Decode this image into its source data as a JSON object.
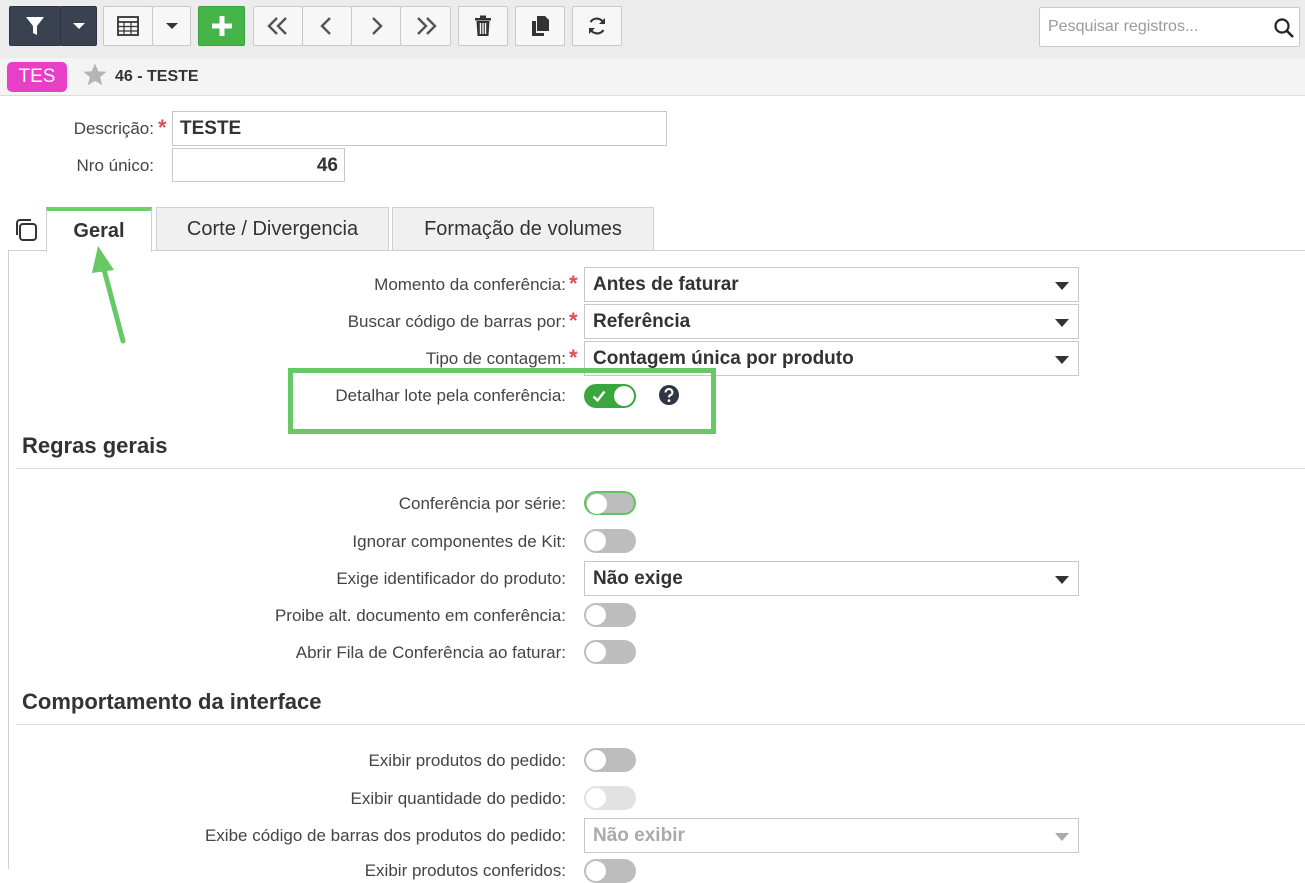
{
  "toolbar": {
    "search_placeholder": "Pesquisar registros..."
  },
  "record": {
    "badge": "TES",
    "title": "46 - TESTE"
  },
  "form": {
    "descricao_label": "Descrição:",
    "descricao_value": "TESTE",
    "nro_label": "Nro único:",
    "nro_value": "46"
  },
  "tabs": [
    {
      "label": "Geral",
      "active": true
    },
    {
      "label": "Corte / Divergencia",
      "active": false
    },
    {
      "label": "Formação de volumes",
      "active": false
    }
  ],
  "geral": {
    "momento_label": "Momento da conferência:",
    "momento_value": "Antes de faturar",
    "buscar_label": "Buscar código de barras por:",
    "buscar_value": "Referência",
    "tipo_label": "Tipo de contagem:",
    "tipo_value": "Contagem única por produto",
    "detalhar_label": "Detalhar lote pela conferência:",
    "detalhar_on": true
  },
  "regras": {
    "title": "Regras gerais",
    "serie_label": "Conferência por série:",
    "kit_label": "Ignorar componentes de Kit:",
    "ident_label": "Exige identificador do produto:",
    "ident_value": "Não exige",
    "proibe_label": "Proibe alt. documento em conferência:",
    "fila_label": "Abrir Fila de Conferência ao faturar:"
  },
  "interface": {
    "title": "Comportamento da interface",
    "exibir_prod_label": "Exibir produtos do pedido:",
    "exibir_qtd_label": "Exibir quantidade do pedido:",
    "exibe_cod_label": "Exibe código de barras dos produtos do pedido:",
    "exibe_cod_value": "Não exibir",
    "exibir_conf_label": "Exibir produtos conferidos:"
  },
  "colors": {
    "accent_green": "#46b549",
    "badge_pink": "#e83fc7",
    "highlight": "#67c965",
    "required": "#d9534f"
  }
}
